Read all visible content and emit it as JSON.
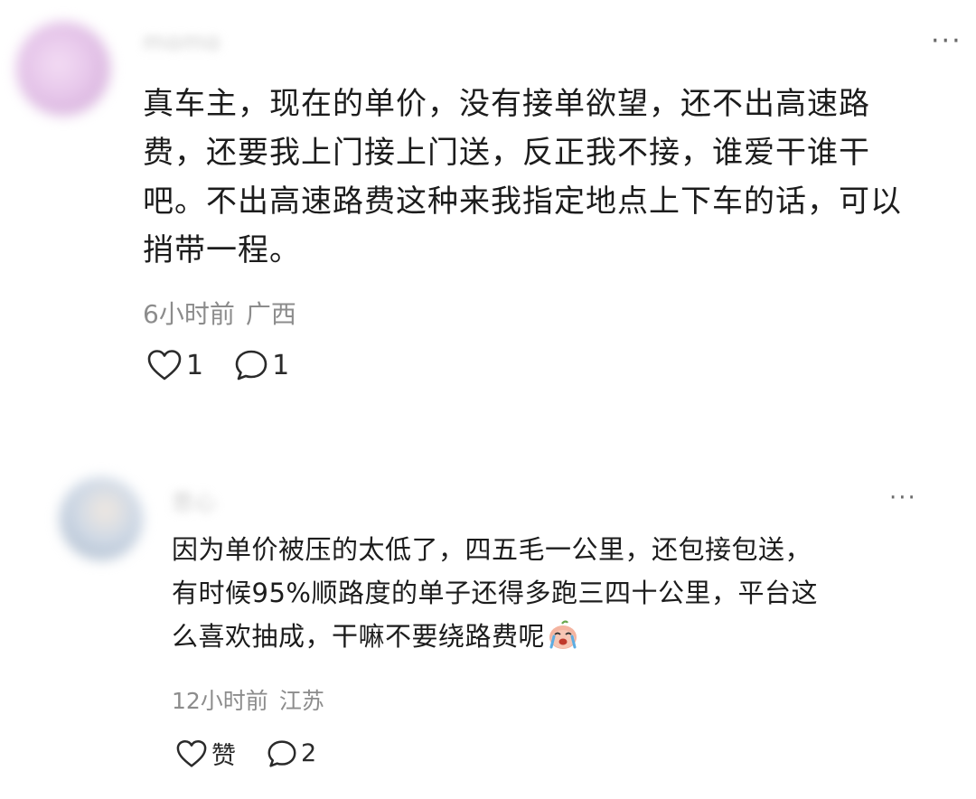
{
  "comments": [
    {
      "username": "momo",
      "text": "真车主，现在的单价，没有接单欲望，还不出高速路\n费，还要我上门接上门送，反正我不接，谁爱干谁干\n吧。不出高速路费这种来我指定地点上下车的话，可以\n捎带一程。",
      "time": "6小时前",
      "location": "广西",
      "likes": "1",
      "replies": "1",
      "more_label": "···"
    },
    {
      "username": "悲心",
      "text": "因为单价被压的太低了，四五毛一公里，还包接包送，\n有时候95%顺路度的单子还得多跑三四十公里，平台这\n么喜欢抽成，干嘛不要绕路费呢",
      "emoji": "crying-face-emoji",
      "time": "12小时前",
      "location": "江苏",
      "likes": "赞",
      "replies": "2",
      "more_label": "···"
    }
  ],
  "colors": {
    "text": "#1c1c1c",
    "meta": "#8c8c8c",
    "icon": "#2a2a2a"
  }
}
